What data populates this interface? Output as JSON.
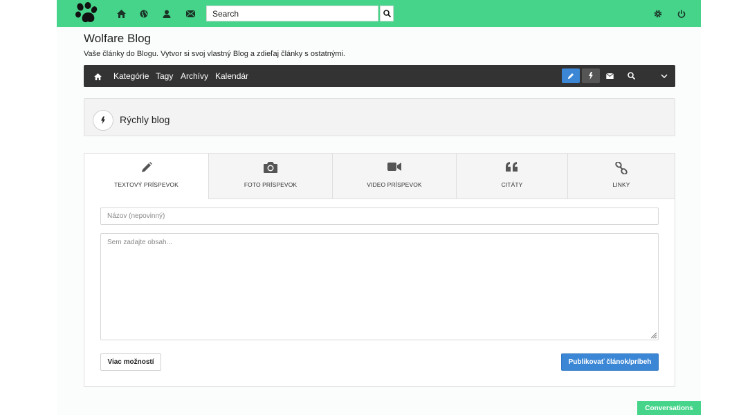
{
  "topbar": {
    "logo_icon": "paw-logo-icon",
    "nav_icons": [
      "home-icon",
      "globe-icon",
      "user-icon",
      "envelope-icon"
    ],
    "search_placeholder": "Search",
    "right_icons": [
      "gear-icon",
      "power-icon"
    ],
    "color": "#45d48a"
  },
  "header": {
    "title": "Wolfare Blog",
    "description": "Vaše články do Blogu. Vytvor si svoj vlastný Blog a zdieľaj články s ostatnými."
  },
  "blognav": {
    "links": [
      "Kategórie",
      "Tagy",
      "Archívy",
      "Kalendár"
    ],
    "buttons": [
      "pencil-icon",
      "bolt-icon",
      "envelope-icon",
      "search-icon",
      "chevron-down-icon"
    ],
    "active_color": "#3b87d6"
  },
  "quick_blog": {
    "title": "Rýchly blog"
  },
  "composer": {
    "tabs": [
      {
        "label": "TEXTOVÝ PRÍSPEVOK",
        "icon": "pencil-icon"
      },
      {
        "label": "FOTO PRÍSPEVOK",
        "icon": "camera-icon"
      },
      {
        "label": "VIDEO PRÍSPEVOK",
        "icon": "video-camera-icon"
      },
      {
        "label": "CITÁTY",
        "icon": "quote-icon"
      },
      {
        "label": "LINKY",
        "icon": "link-icon"
      }
    ],
    "title_placeholder": "Názov (nepovinný)",
    "content_placeholder": "Sem zadajte obsah...",
    "more_label": "Viac možností",
    "publish_label": "Publikovať článok/príbeh"
  },
  "conversations_label": "Conversations"
}
